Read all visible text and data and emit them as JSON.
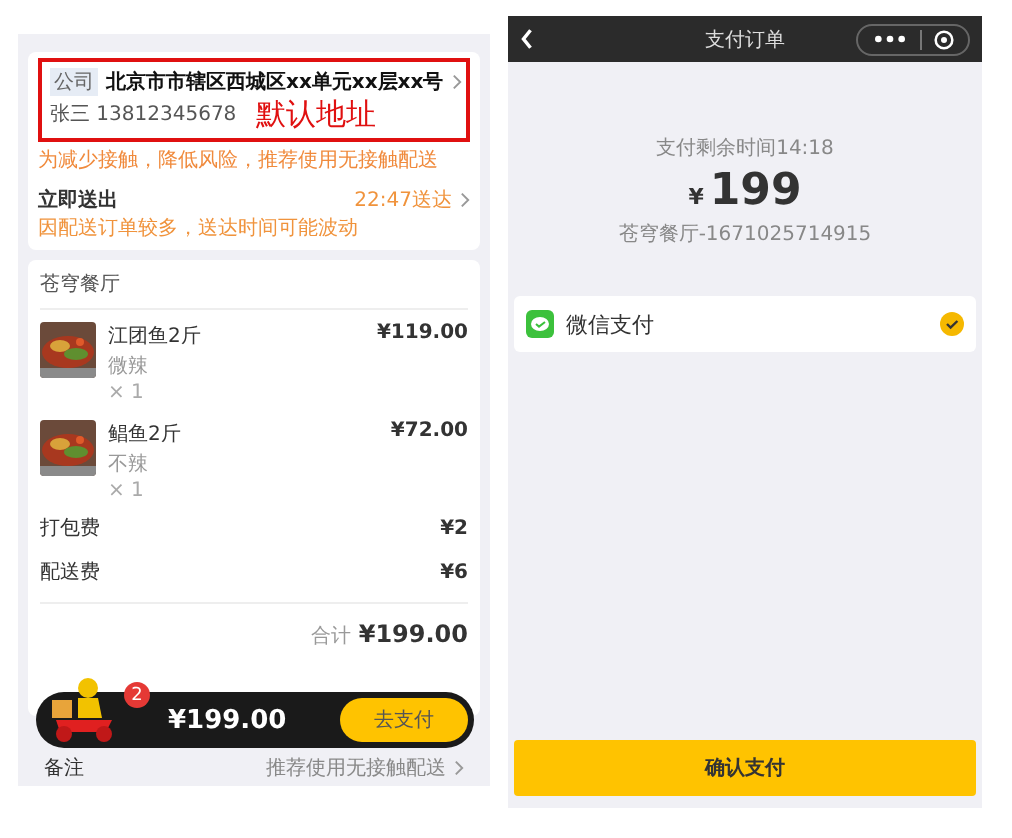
{
  "order_page": {
    "address": {
      "tag": "公司",
      "text": "北京市市辖区西城区xx单元xx层xx号",
      "contact": "张三 13812345678",
      "annotation": "默认地址"
    },
    "tip": "为减少接触，降低风险，推荐使用无接触配送",
    "delivery": {
      "label": "立即送出",
      "time": "22:47送达",
      "note": "因配送订单较多，送达时间可能波动"
    },
    "shop": {
      "name": "苍穹餐厅",
      "items": [
        {
          "name": "江团鱼2斤",
          "spec": "微辣",
          "qty": "× 1",
          "price": "¥119.00"
        },
        {
          "name": "鲳鱼2斤",
          "spec": "不辣",
          "qty": "× 1",
          "price": "¥72.00"
        }
      ]
    },
    "fees": [
      {
        "label": "打包费",
        "value": "¥2"
      },
      {
        "label": "配送费",
        "value": "¥6"
      }
    ],
    "total": {
      "label": "合计",
      "value": "¥199.00"
    },
    "cart_bar": {
      "badge": "2",
      "amount": "¥199.00",
      "button": "去支付"
    },
    "remark": {
      "label": "备注",
      "value": "推荐使用无接触配送"
    }
  },
  "payment_page": {
    "title": "支付订单",
    "countdown": "支付剩余时间14:18",
    "currency": "¥",
    "amount": "199",
    "order_ref": "苍穹餐厅-1671025714915",
    "methods": [
      {
        "name": "微信支付",
        "selected": true
      }
    ],
    "confirm": "确认支付"
  }
}
